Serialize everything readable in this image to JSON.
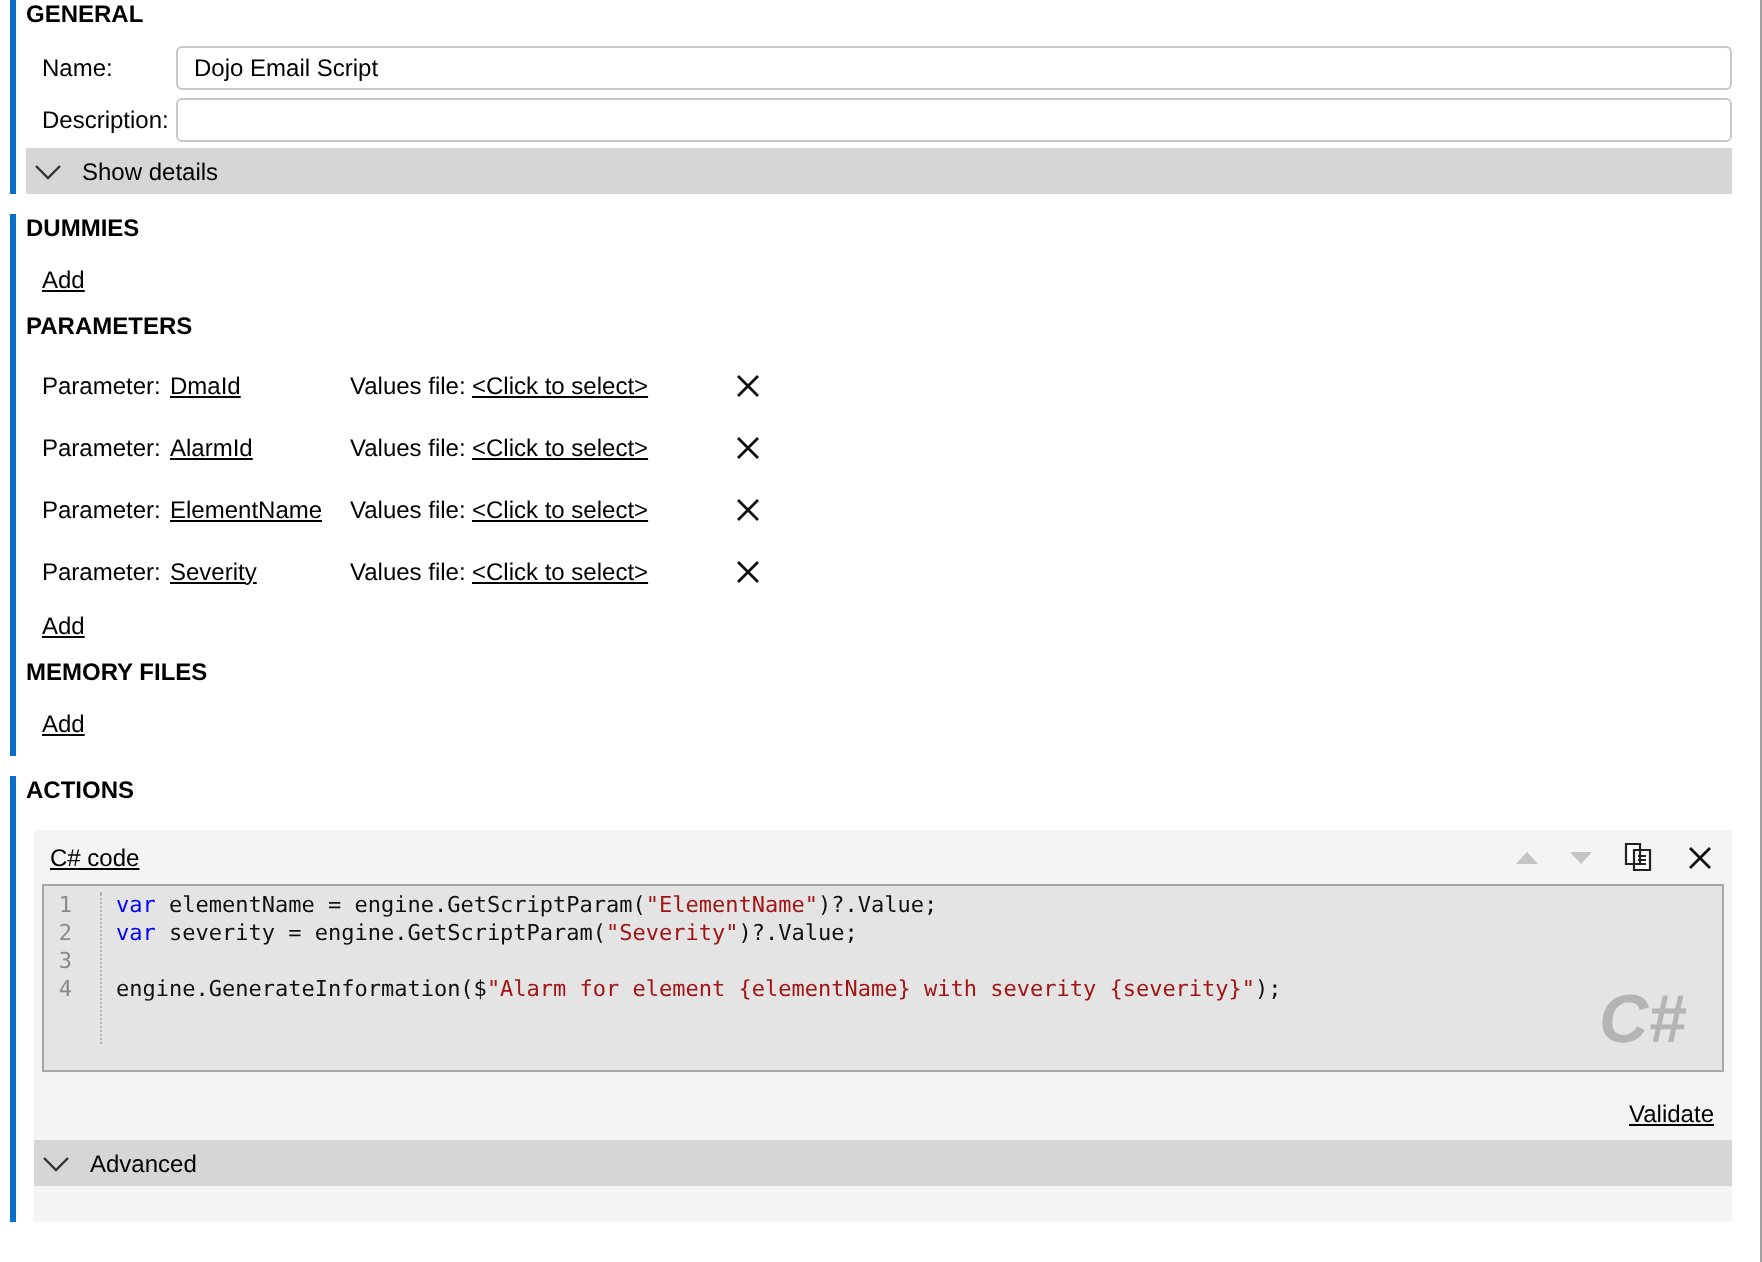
{
  "groups": [
    {
      "sections": [
        {
          "kind": "general",
          "title": "GENERAL",
          "fields": [
            {
              "label": "Name:",
              "value": "Dojo Email Script"
            },
            {
              "label": "Description:"
            }
          ],
          "expander": {
            "label": "Show details",
            "expanded": false
          }
        }
      ]
    },
    {
      "sections": [
        {
          "kind": "list",
          "title": "DUMMIES",
          "add": "Add"
        },
        {
          "kind": "list",
          "title": "PARAMETERS",
          "items": [
            {
              "label": "Parameter:",
              "name": "DmaId",
              "file_label": "Values file:",
              "file": "<Click to select>"
            },
            {
              "label": "Parameter:",
              "name": "AlarmId",
              "file_label": "Values file:",
              "file": "<Click to select>"
            },
            {
              "label": "Parameter:",
              "name": "ElementName",
              "file_label": "Values file:",
              "file": "<Click to select>"
            },
            {
              "label": "Parameter:",
              "name": "Severity",
              "file_label": "Values file:",
              "file": "<Click to select>"
            }
          ],
          "add": "Add"
        },
        {
          "kind": "list",
          "title": "MEMORY FILES",
          "add": "Add"
        }
      ]
    },
    {
      "sections": [
        {
          "kind": "actions",
          "title": "ACTIONS",
          "action": {
            "title": "C# code",
            "up_disabled": true,
            "down_disabled": true,
            "lines": [
              {
                "number": "1",
                "tokens": [
                  {
                    "kind": "keyword",
                    "text": "var"
                  },
                  {
                    "kind": "plain",
                    "text": " elementName = engine.GetScriptParam("
                  },
                  {
                    "kind": "string",
                    "text": "\"ElementName\""
                  },
                  {
                    "kind": "plain",
                    "text": ")?.Value;"
                  }
                ]
              },
              {
                "number": "2",
                "tokens": [
                  {
                    "kind": "keyword",
                    "text": "var"
                  },
                  {
                    "kind": "plain",
                    "text": " severity = engine.GetScriptParam("
                  },
                  {
                    "kind": "string",
                    "text": "\"Severity\""
                  },
                  {
                    "kind": "plain",
                    "text": ")?.Value;"
                  }
                ]
              },
              {
                "number": "3"
              },
              {
                "number": "4",
                "tokens": [
                  {
                    "kind": "plain",
                    "text": "engine.GenerateInformation($"
                  },
                  {
                    "kind": "string",
                    "text": "\"Alarm for element {elementName} with severity {severity}\""
                  },
                  {
                    "kind": "plain",
                    "text": ");"
                  }
                ]
              }
            ],
            "watermark": "C#",
            "validate": "Validate",
            "expander": {
              "label": "Advanced",
              "expanded": false
            }
          }
        }
      ]
    }
  ]
}
